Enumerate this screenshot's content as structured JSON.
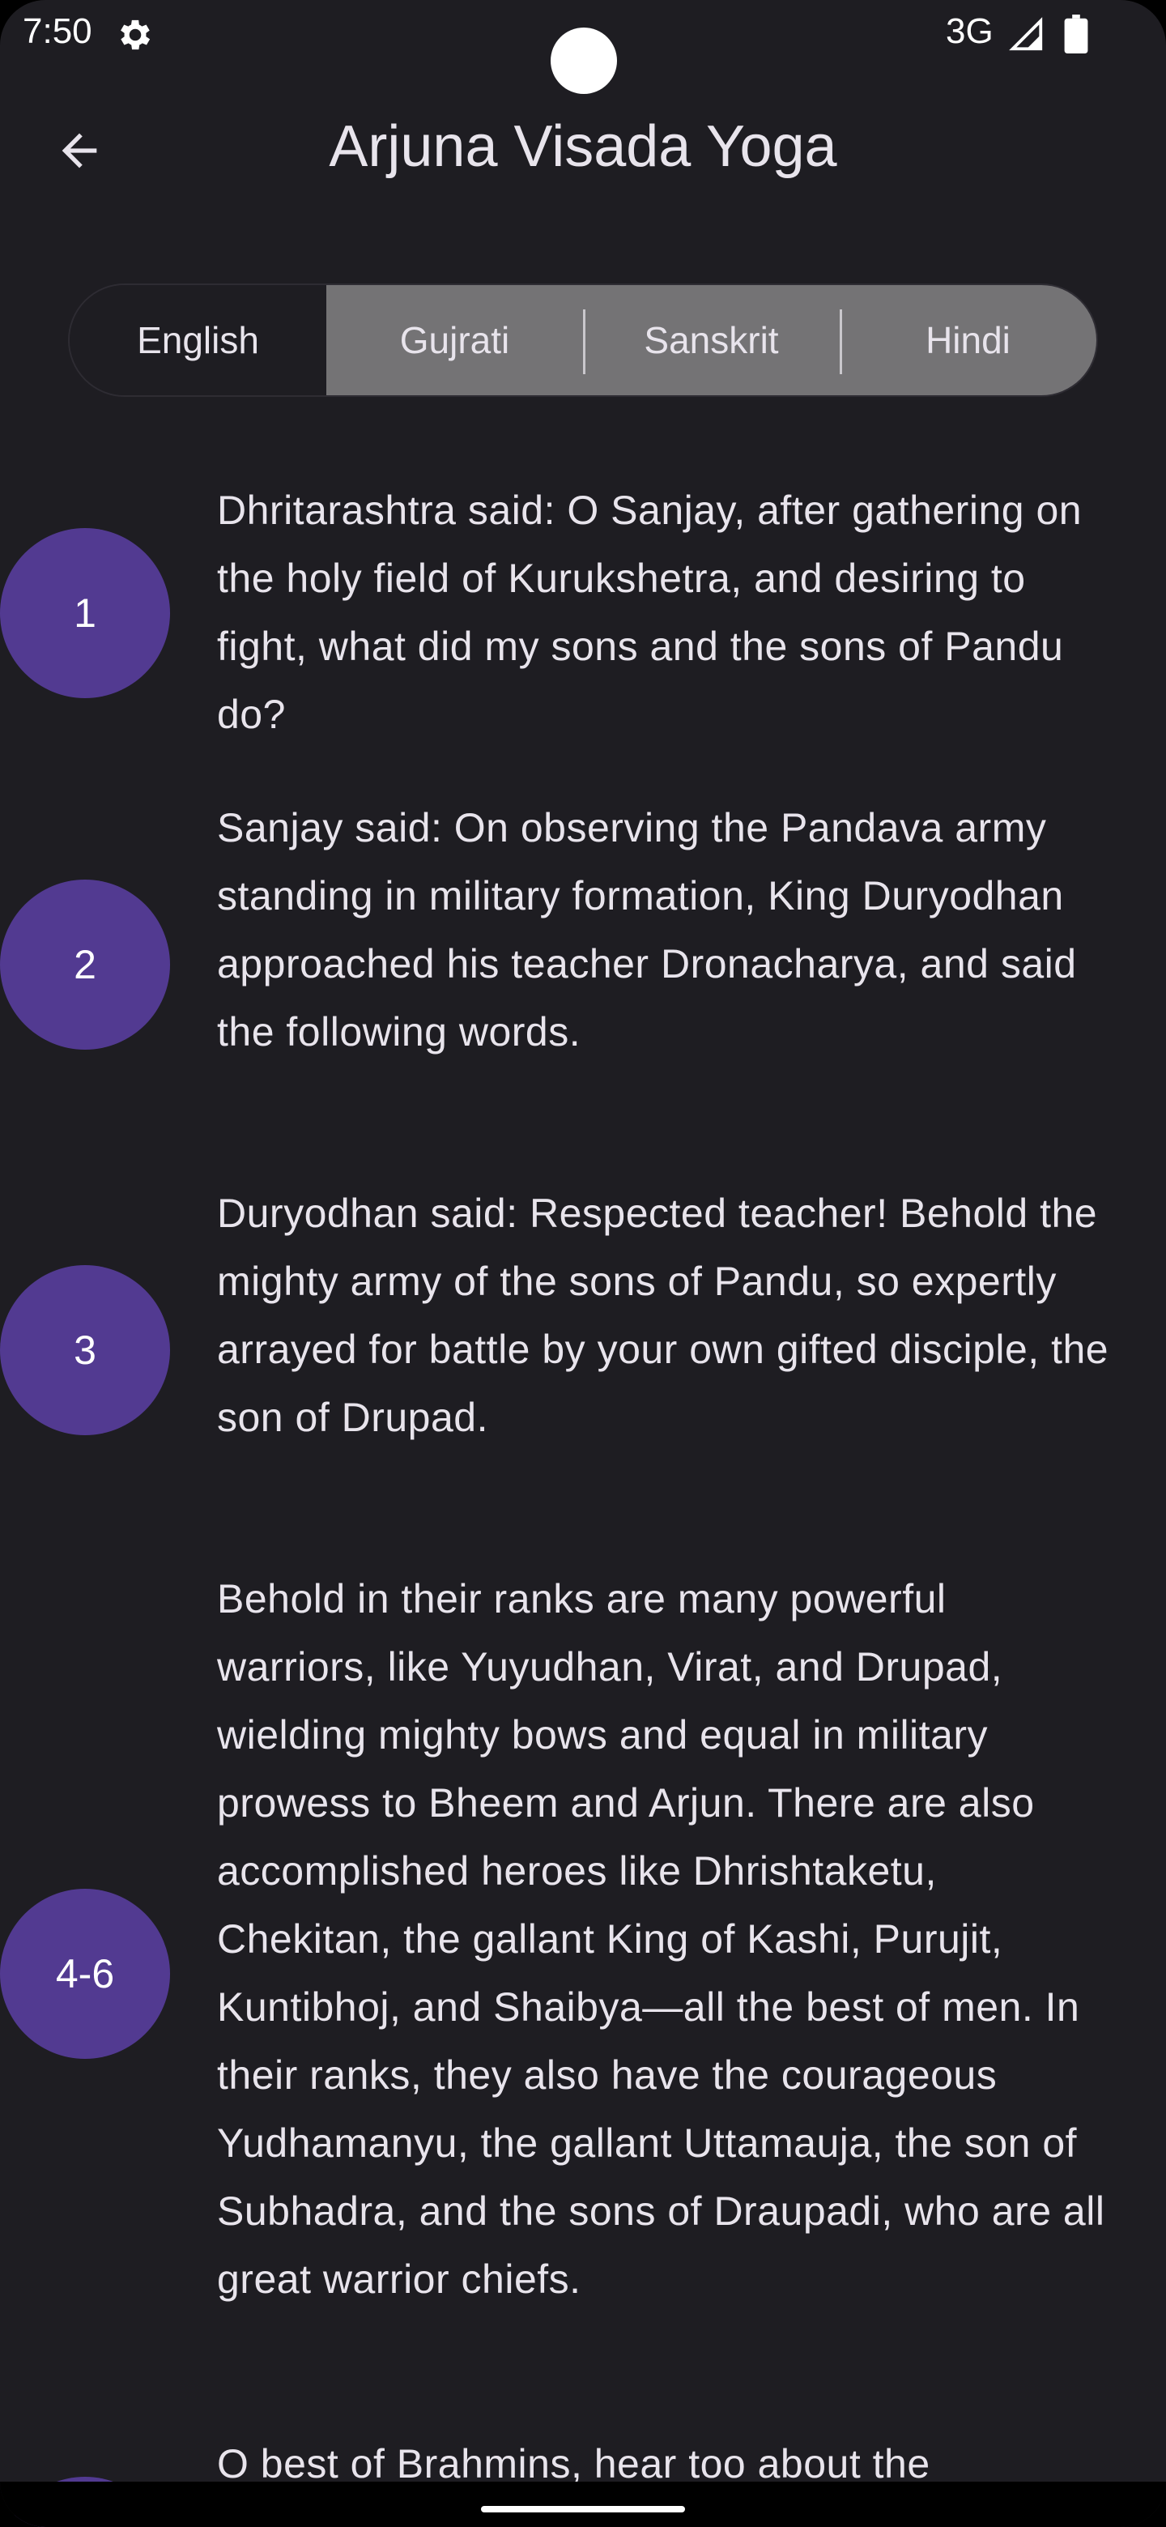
{
  "status_bar": {
    "time": "7:50",
    "network": "3G",
    "icons": [
      "gear-icon",
      "signal-icon",
      "battery-icon"
    ]
  },
  "app_bar": {
    "back_icon": "arrow-left-icon",
    "title": "Arjuna Visada Yoga"
  },
  "languages": {
    "selected": "English",
    "options": [
      "English",
      "Gujrati",
      "Sanskrit",
      "Hindi"
    ]
  },
  "verses": [
    {
      "number": "1",
      "text": "Dhritarashtra said: O Sanjay, after gathering on the holy field of Kurukshetra, and desiring to fight, what did my sons and the sons of Pandu do?"
    },
    {
      "number": "2",
      "text": "Sanjay said: On observing the Pandava army standing in military formation, King Duryodhan approached his teacher Dronacharya, and said the following words."
    },
    {
      "number": "3",
      "text": "Duryodhan said: Respected teacher! Behold the mighty army of the sons of Pandu, so expertly arrayed for battle by your own gifted disciple, the son of Drupad."
    },
    {
      "number": "4-6",
      "text": "Behold in their ranks are many powerful warriors, like Yuyudhan, Virat, and Drupad, wielding mighty bows and equal in military prowess to Bheem and Arjun. There are also accomplished heroes like Dhrishtaketu, Chekitan, the gallant King of Kashi, Purujit, Kuntibhoj, and Shaibya—all the best of men. In their ranks, they also have the courageous Yudhamanyu, the gallant Uttamauja, the son of Subhadra, and the sons of Draupadi, who are all great warrior chiefs."
    },
    {
      "number": "",
      "text": "O best of Brahmins, hear too about the"
    }
  ],
  "colors": {
    "background": "#1e1d22",
    "badge": "#523a91",
    "segment_unselected": "#747375",
    "text": "#e8e4ec"
  }
}
